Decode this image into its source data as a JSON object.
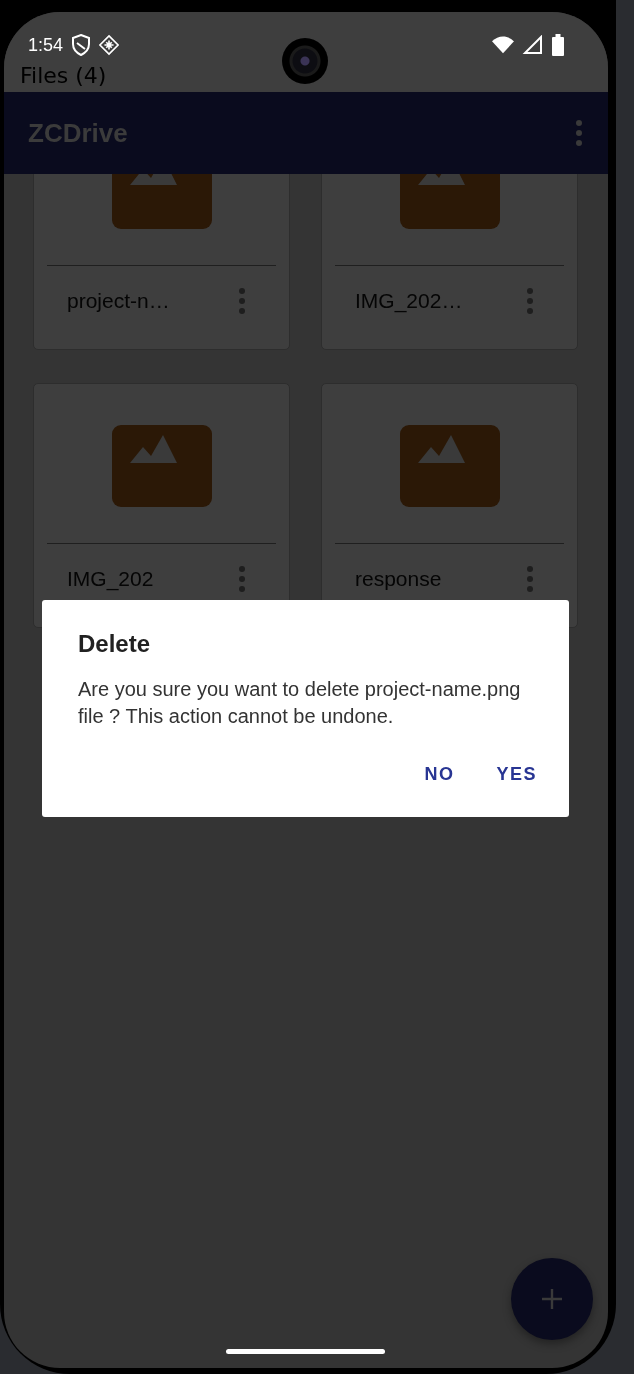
{
  "status_bar": {
    "time": "1:54"
  },
  "screen_title": "Files (4)",
  "app_bar": {
    "title": "ZCDrive"
  },
  "files": [
    {
      "name": "project-n…"
    },
    {
      "name": "IMG_202…"
    },
    {
      "name": "IMG_202"
    },
    {
      "name": "response"
    }
  ],
  "dialog": {
    "title": "Delete",
    "message": "Are you sure you want to delete project-name.png file ? This action cannot be undone.",
    "buttons": [
      "NO",
      "YES"
    ]
  }
}
